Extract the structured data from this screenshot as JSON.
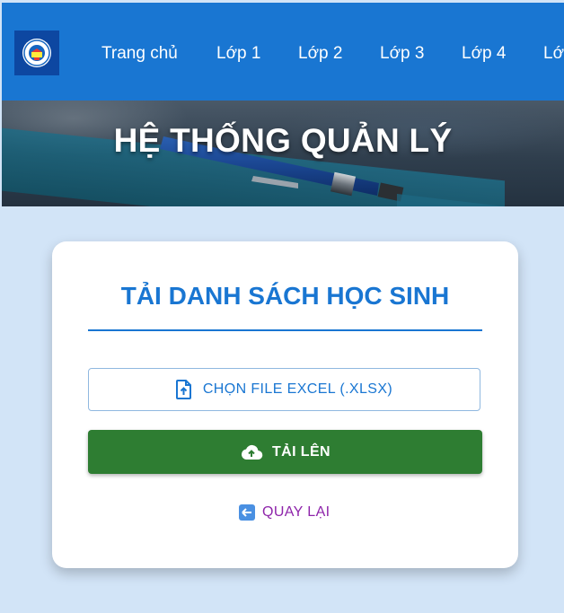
{
  "navbar": {
    "logo": "school-logo-icon",
    "items": [
      {
        "label": "Trang chủ"
      },
      {
        "label": "Lớp 1"
      },
      {
        "label": "Lớp 2"
      },
      {
        "label": "Lớp 3"
      },
      {
        "label": "Lớp 4"
      },
      {
        "label": "Lớ"
      }
    ]
  },
  "banner": {
    "title": "HỆ THỐNG QUẢN LÝ"
  },
  "card": {
    "title": "TẢI DANH SÁCH HỌC SINH",
    "choose_file_label": "CHỌN FILE EXCEL (.XLSX)",
    "choose_file_icon": "file-upload-icon",
    "upload_label": "TẢI LÊN",
    "upload_icon": "cloud-upload-icon",
    "back_label": "QUAY LẠI",
    "back_icon": "back-arrow-icon"
  },
  "colors": {
    "primary": "#1976d2",
    "success": "#2e7d32",
    "back_link": "#8e24aa",
    "page_bg": "#d2e4f7"
  }
}
